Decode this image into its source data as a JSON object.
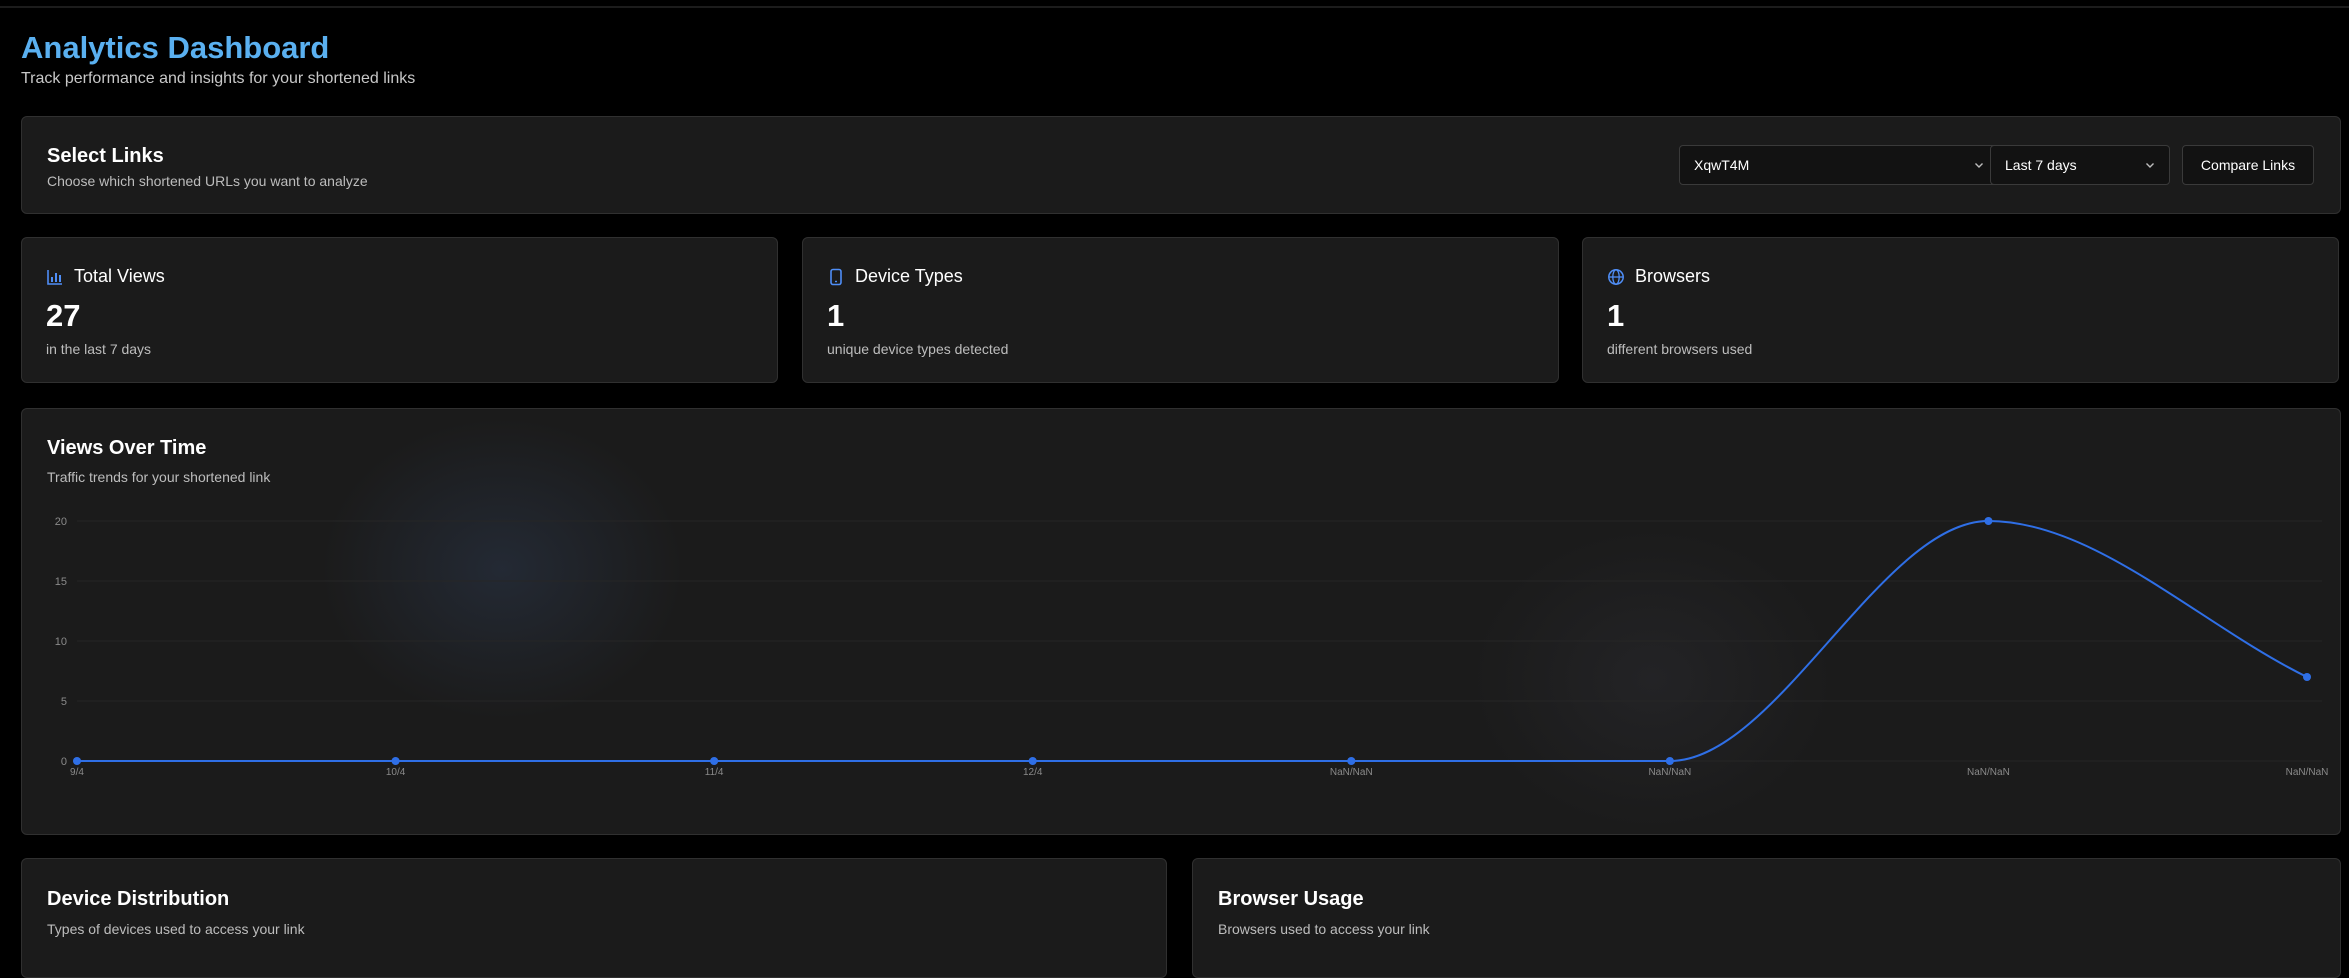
{
  "header": {
    "title": "Analytics Dashboard",
    "subtitle": "Track performance and insights for your shortened links"
  },
  "select_links": {
    "title": "Select Links",
    "description": "Choose which shortened URLs you want to analyze",
    "link_value": "XqwT4M",
    "range_value": "Last 7 days",
    "compare_label": "Compare Links"
  },
  "stats": {
    "views": {
      "label": "Total Views",
      "value": "27",
      "sub": "in the last 7 days",
      "icon": "bar-chart-icon"
    },
    "devices": {
      "label": "Device Types",
      "value": "1",
      "sub": "unique device types detected",
      "icon": "smartphone-icon"
    },
    "browsers": {
      "label": "Browsers",
      "value": "1",
      "sub": "different browsers used",
      "icon": "globe-icon"
    }
  },
  "views_chart": {
    "title": "Views Over Time",
    "description": "Traffic trends for your shortened link"
  },
  "device_distribution": {
    "title": "Device Distribution",
    "description": "Types of devices used to access your link"
  },
  "browser_usage": {
    "title": "Browser Usage",
    "description": "Browsers used to access your link"
  },
  "colors": {
    "accent": "#5ab0f0",
    "line": "#2f6fe6",
    "background": "#000000",
    "card": "#1b1b1b"
  },
  "chart_data": {
    "type": "line",
    "categories": [
      "9/4",
      "10/4",
      "11/4",
      "12/4",
      "NaN/NaN",
      "NaN/NaN",
      "NaN/NaN",
      "NaN/NaN"
    ],
    "series": [
      {
        "values": [
          0,
          0,
          0,
          0,
          0,
          0,
          20,
          7
        ]
      }
    ],
    "yticks": [
      0,
      5,
      10,
      15,
      20
    ],
    "ylim": [
      0,
      20
    ],
    "grid": true,
    "legend": "none"
  }
}
